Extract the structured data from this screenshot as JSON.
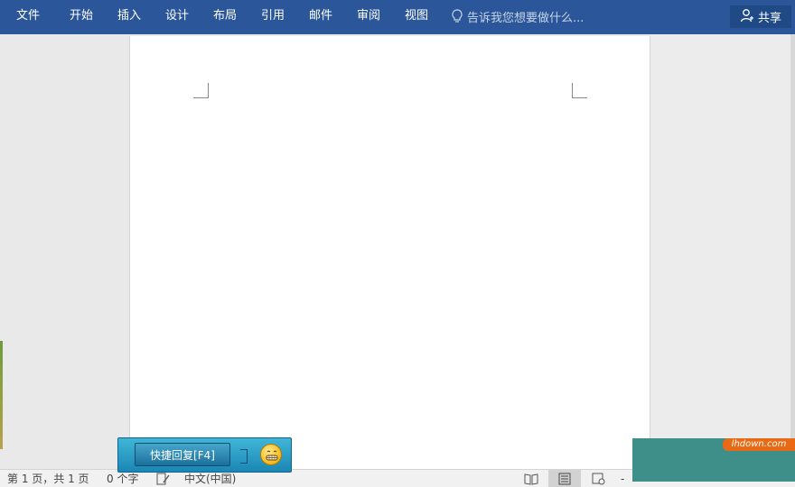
{
  "ribbon": {
    "tabs": [
      "文件",
      "开始",
      "插入",
      "设计",
      "布局",
      "引用",
      "邮件",
      "审阅",
      "视图"
    ],
    "tell_me": "告诉我您想要做什么...",
    "share": "共享",
    "colors": {
      "bar": "#2b579a",
      "share_bg": "#1f4a86"
    }
  },
  "statusbar": {
    "page_info": "第 1 页，共 1 页",
    "word_count": "0 个字",
    "language": "中文(中国)",
    "zoom_minus": "-",
    "views": [
      "read-mode-icon",
      "print-layout-icon",
      "web-layout-icon"
    ],
    "active_view": "print-layout-icon"
  },
  "quick_reply": {
    "label": "快捷回复[F4]",
    "icon": "grinning-face-icon"
  },
  "watermark": {
    "site": "lhdown.com",
    "colors": {
      "banner": "#3e8f8a",
      "tag": "#e86a14"
    }
  }
}
